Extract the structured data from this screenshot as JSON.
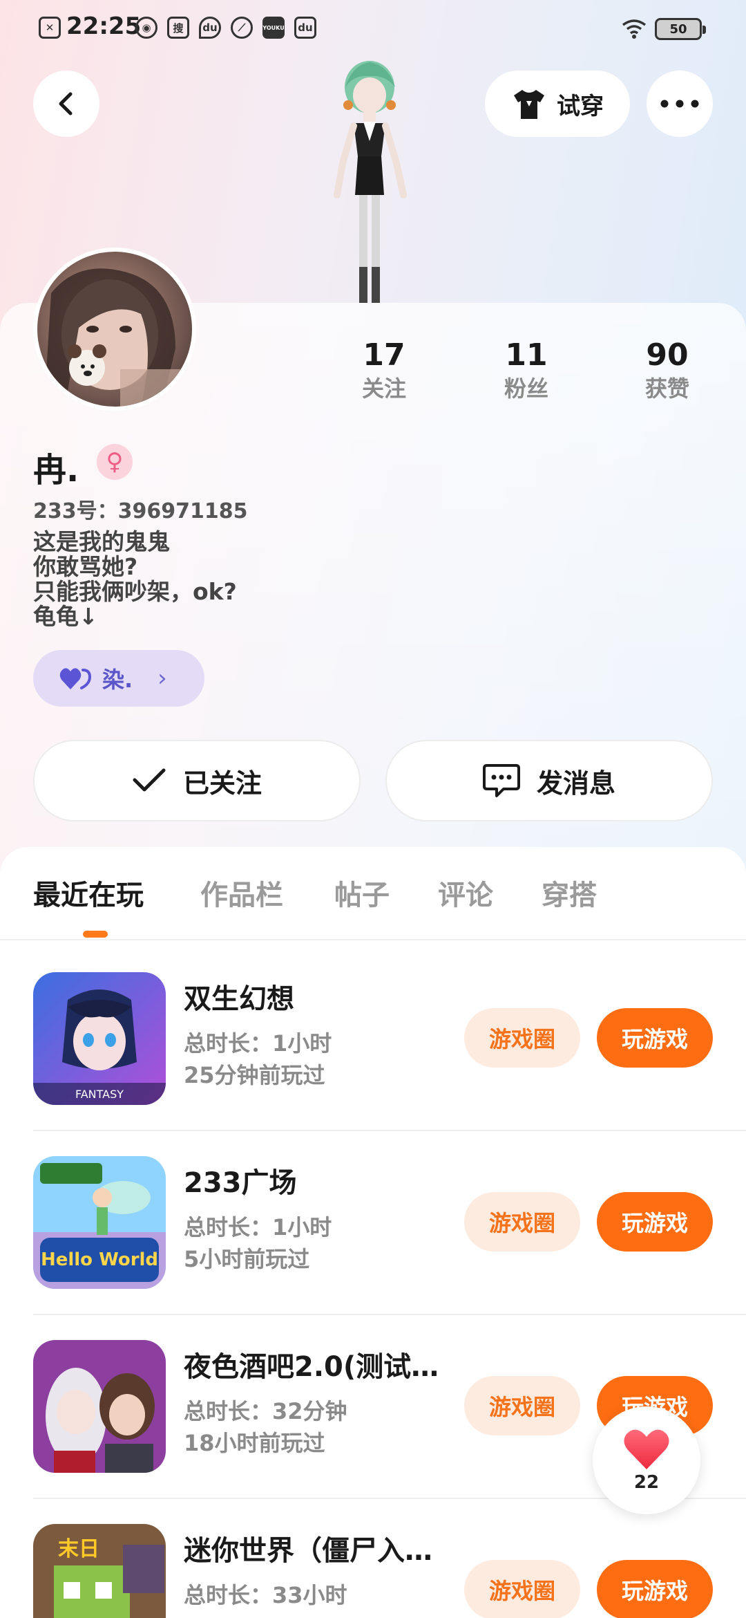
{
  "status_bar": {
    "time": "22:25",
    "icons": [
      {
        "name": "notification-x-icon",
        "glyph": "✕"
      },
      {
        "name": "weibo-icon",
        "glyph": "◉"
      },
      {
        "name": "sogou-icon",
        "glyph": "搜"
      },
      {
        "name": "location-app-icon",
        "glyph": "du"
      },
      {
        "name": "leaf-app-icon",
        "glyph": "⟋"
      },
      {
        "name": "youku-icon",
        "glyph": "YOUKU"
      },
      {
        "name": "du-app-icon",
        "glyph": "du"
      }
    ],
    "battery": "50"
  },
  "header": {
    "try_on_label": "试穿"
  },
  "profile": {
    "stats": [
      {
        "value": "17",
        "label": "关注"
      },
      {
        "value": "11",
        "label": "粉丝"
      },
      {
        "value": "90",
        "label": "获赞"
      }
    ],
    "nickname": "冉.",
    "gender_glyph": "♀",
    "user_id": "233号：396971185",
    "bio_lines": [
      "这是我的鬼鬼",
      "你敢骂她?",
      "只能我俩吵架，ok?",
      "龟龟↓"
    ],
    "friend_chip": {
      "name": "染.",
      "arrow": "›"
    },
    "followed_label": "已关注",
    "message_label": "发消息"
  },
  "tabs": [
    "最近在玩",
    "作品栏",
    "帖子",
    "评论",
    "穿搭"
  ],
  "games": [
    {
      "title": "双生幻想",
      "duration": "总时长：1小时",
      "last_played": "25分钟前玩过",
      "circle_label": "游戏圈",
      "play_label": "玩游戏",
      "icon_text": "FANTASY"
    },
    {
      "title": "233广场",
      "duration": "总时长：1小时",
      "last_played": "5小时前玩过",
      "circle_label": "游戏圈",
      "play_label": "玩游戏",
      "icon_text": "Hello World"
    },
    {
      "title": "夜色酒吧2.0(测试…",
      "duration": "总时长：32分钟",
      "last_played": "18小时前玩过",
      "circle_label": "游戏圈",
      "play_label": "玩游戏",
      "icon_text": ""
    },
    {
      "title": "迷你世界（僵尸入…",
      "duration": "总时长：33小时",
      "last_played": "",
      "circle_label": "游戏圈",
      "play_label": "玩游戏",
      "icon_text": "末日"
    }
  ],
  "like_float": {
    "count": "22"
  },
  "colors": {
    "accent": "#ff6d12",
    "accent_soft": "#fdebe0",
    "chip_bg": "#e4dcf7",
    "chip_text": "#5a55c8",
    "heart": "#f0394f"
  }
}
